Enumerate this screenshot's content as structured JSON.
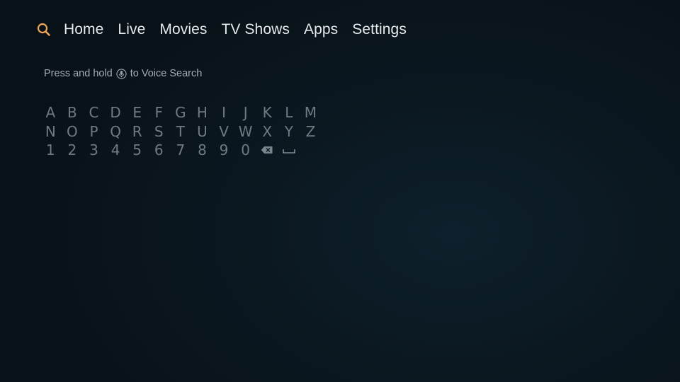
{
  "colors": {
    "accent": "#f0a657",
    "nav_text": "#e6eaed",
    "hint_text": "#a3acb2",
    "key_text": "#6f7a82",
    "background": "#0b1821"
  },
  "nav": {
    "search_icon": "search-icon",
    "items": [
      {
        "label": "Home"
      },
      {
        "label": "Live"
      },
      {
        "label": "Movies"
      },
      {
        "label": "TV Shows"
      },
      {
        "label": "Apps"
      },
      {
        "label": "Settings"
      }
    ]
  },
  "hint": {
    "before": "Press and hold",
    "icon": "microphone-icon",
    "after": "to Voice Search"
  },
  "keyboard": {
    "rows": [
      [
        "A",
        "B",
        "C",
        "D",
        "E",
        "F",
        "G",
        "H",
        "I",
        "J",
        "K",
        "L",
        "M"
      ],
      [
        "N",
        "O",
        "P",
        "Q",
        "R",
        "S",
        "T",
        "U",
        "V",
        "W",
        "X",
        "Y",
        "Z"
      ],
      [
        "1",
        "2",
        "3",
        "4",
        "5",
        "6",
        "7",
        "8",
        "9",
        "0"
      ]
    ],
    "backspace_icon": "backspace-icon",
    "space_icon": "space-icon"
  }
}
